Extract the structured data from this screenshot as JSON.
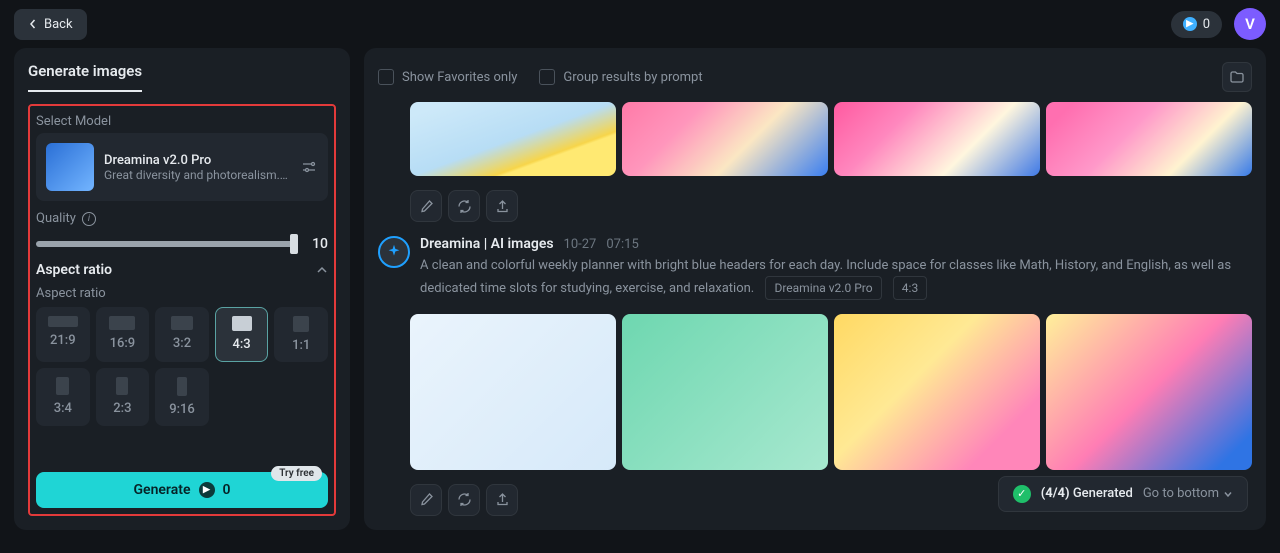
{
  "topbar": {
    "back": "Back",
    "credits": "0",
    "avatar_initial": "V"
  },
  "sidebar": {
    "title": "Generate images",
    "select_model_label": "Select Model",
    "model": {
      "name": "Dreamina v2.0 Pro",
      "desc": "Great diversity and photorealism. Of..."
    },
    "quality_label": "Quality",
    "quality_value": "10",
    "aspect_ratio_title": "Aspect ratio",
    "aspect_ratio_sub": "Aspect ratio",
    "ratios": [
      "21:9",
      "16:9",
      "3:2",
      "4:3",
      "1:1",
      "3:4",
      "2:3",
      "9:16"
    ],
    "selected_ratio": "4:3",
    "generate_label": "Generate",
    "generate_cost": "0",
    "try_free": "Try free"
  },
  "content": {
    "show_favorites": "Show Favorites only",
    "group_prompt": "Group results by prompt",
    "prompt": {
      "author": "Dreamina | AI images",
      "date": "10-27",
      "time": "07:15",
      "text": "A clean and colorful weekly planner with bright blue headers for each day. Include space for classes like Math, History, and English, as well as dedicated time slots for studying, exercise, and relaxation.",
      "model_tag": "Dreamina v2.0 Pro",
      "ratio_tag": "4:3"
    },
    "status": {
      "count": "(4/4)",
      "label": "Generated",
      "goto": "Go to bottom"
    }
  }
}
